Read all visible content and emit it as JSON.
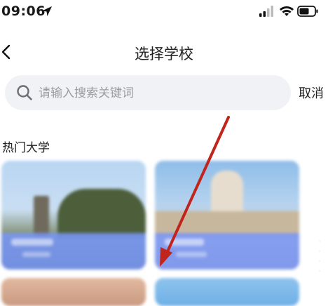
{
  "status_bar": {
    "time": "09:06"
  },
  "nav": {
    "title": "选择学校"
  },
  "search": {
    "placeholder": "请输入搜索关键词",
    "value": "",
    "cancel_label": "取消"
  },
  "section": {
    "title": "热门大学"
  },
  "colors": {
    "accent_overlay": "#7896fa",
    "search_bg": "#f1f2f5",
    "annotation_arrow": "#c0241b"
  }
}
